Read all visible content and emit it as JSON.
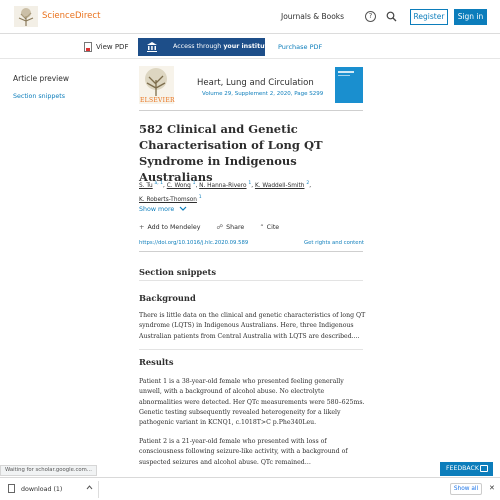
{
  "header": {
    "brand": "ScienceDirect",
    "journals_books": "Journals & Books",
    "help_glyph": "?",
    "register": "Register",
    "sign_in": "Sign in",
    "icons": [
      "elsevier-tree-logo",
      "help-icon",
      "search-icon"
    ]
  },
  "toolbar": {
    "view_pdf": "View PDF",
    "access_prefix": "Access through ",
    "access_bold": "your institution",
    "purchase_pdf": "Purchase PDF"
  },
  "sidebar": {
    "title": "Article preview",
    "link": "Section snippets"
  },
  "journal": {
    "publisher": "ELSEVIER",
    "name": "Heart, Lung and Circulation",
    "volume": "Volume 29, Supplement 2, 2020, Page S299"
  },
  "article": {
    "title": "582 Clinical and Genetic Characterisation of Long QT Syndrome in Indigenous Australians",
    "authors": [
      {
        "name": "S. Tu",
        "sup": "a, 1",
        "sep": ", "
      },
      {
        "name": "C. Wong",
        "sup": "1",
        "sep": ", "
      },
      {
        "name": "N. Hanna-Rivero",
        "sup": "1",
        "sep": ", "
      },
      {
        "name": "K. Waddell-Smith",
        "sup": "2",
        "sep": ","
      },
      {
        "name": "K. Roberts-Thomson",
        "sup": "1",
        "sep": ""
      }
    ],
    "show_more": "Show more",
    "actions": {
      "add_mendeley": "Add to Mendeley",
      "share": "Share",
      "cite": "Cite"
    },
    "doi": "https://doi.org/10.1016/j.hlc.2020.09.589",
    "rights": "Get rights and content"
  },
  "content": {
    "section_snippets": "Section snippets",
    "background_heading": "Background",
    "background_text": "There is little data on the clinical and genetic characteristics of long QT syndrome (LQTS) in Indigenous Australians. Here, three Indigenous Australian patients from Central Australia with LQTS are described....",
    "results_heading": "Results",
    "results_p1": "Patient 1 is a 38-year-old female who presented feeling generally unwell, with a background of alcohol abuse. No electrolyte abnormalities were detected. Her QTc measurements were 580–625ms. Genetic testing subsequently revealed heterogeneity for a likely pathogenic variant in KCNQ1, c.1018T>C p.Phe340Leu.",
    "results_p2": "Patient 2 is a 21-year-old female who presented with loss of consciousness following seizure-like activity, with a background of suspected seizures and alcohol abuse. QTc remained…"
  },
  "status_bar": "Waiting for scholar.google.com...",
  "feedback": "FEEDBACK",
  "download_bar": {
    "file": "download (1)",
    "show_all": "Show all",
    "close": "✕"
  },
  "colors": {
    "brand_orange": "#e9711c",
    "link_blue": "#0c7dbb",
    "access_navy": "#1d4e89"
  }
}
